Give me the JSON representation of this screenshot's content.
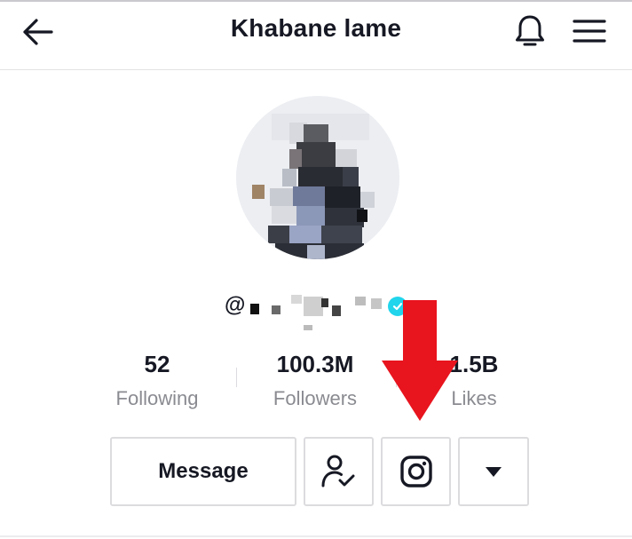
{
  "header": {
    "title": "Khabane lame",
    "back_icon": "arrow-left-icon",
    "bell_icon": "bell-icon",
    "menu_icon": "hamburger-menu-icon"
  },
  "profile": {
    "username_prefix": "@",
    "verified_icon": "verified-check-icon"
  },
  "stats": [
    {
      "value": "52",
      "label": "Following"
    },
    {
      "value": "100.3M",
      "label": "Followers"
    },
    {
      "value": "1.5B",
      "label": "Likes"
    }
  ],
  "actions": {
    "message_label": "Message",
    "friend_icon": "user-check-icon",
    "instagram_icon": "instagram-icon",
    "more_icon": "caret-down-icon"
  },
  "annotation": {
    "arrow_icon": "red-arrow-down-icon",
    "arrow_color": "#e8141e"
  },
  "colors": {
    "text": "#161823",
    "muted": "#8a8b91",
    "border": "#dcdcdf",
    "verified": "#20d5ec"
  }
}
